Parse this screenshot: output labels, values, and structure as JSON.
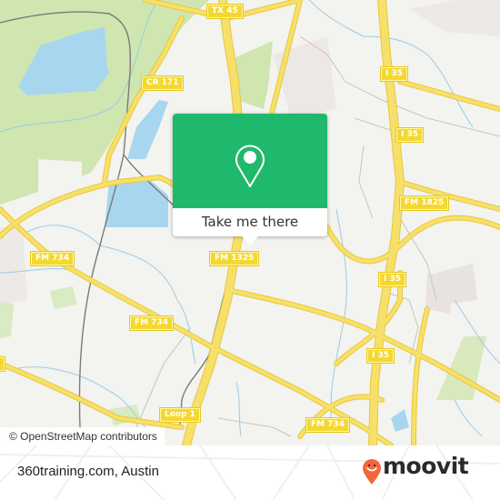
{
  "map": {
    "attribution": "© OpenStreetMap contributors",
    "colors": {
      "background": "#f3f3f0",
      "park": "#cfe6b0",
      "water": "#a8d6ee",
      "road": "#f7e06a",
      "road_casing": "#e7c83a",
      "rail": "#777777",
      "stream": "#9ccbe6",
      "built": "#e9e3e0"
    },
    "road_labels": [
      {
        "id": "tx45",
        "text": "TX 45"
      },
      {
        "id": "cr171",
        "text": "CR 171"
      },
      {
        "id": "i35-a",
        "text": "I 35"
      },
      {
        "id": "i35-b",
        "text": "I 35"
      },
      {
        "id": "fm1825",
        "text": "FM 1825"
      },
      {
        "id": "fm1325",
        "text": "FM 1325"
      },
      {
        "id": "fm734-a",
        "text": "FM 734"
      },
      {
        "id": "fm734-b",
        "text": "FM 734"
      },
      {
        "id": "i35-c",
        "text": "I 35"
      },
      {
        "id": "i35-d",
        "text": "I 35"
      },
      {
        "id": "loop1",
        "text": "Loop 1"
      },
      {
        "id": "fm734-c",
        "text": "FM 734"
      }
    ]
  },
  "popup": {
    "button_label": "Take me there",
    "accent_color": "#1fb96d",
    "icon": "map-pin-icon"
  },
  "footer": {
    "place_name": "360training.com, Austin",
    "brand": "moovit",
    "brand_color": "#f2663a"
  }
}
